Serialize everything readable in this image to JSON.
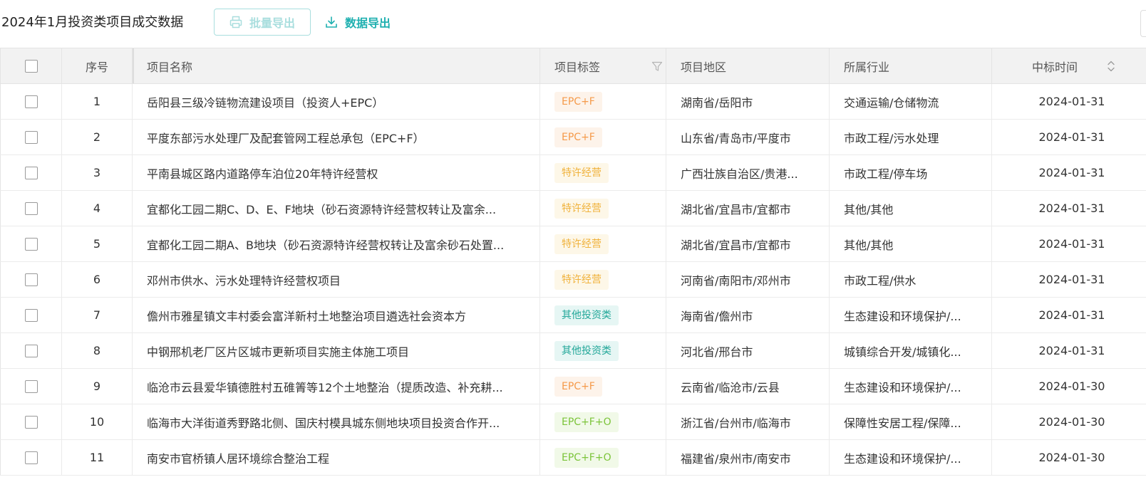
{
  "header": {
    "title": "2024年1月投资类项目成交数据",
    "batch_export_label": "批量导出",
    "data_export_label": "数据导出"
  },
  "table": {
    "columns": {
      "seq": "序号",
      "name": "项目名称",
      "tag": "项目标签",
      "region": "项目地区",
      "industry": "所属行业",
      "date": "中标时间"
    },
    "rows": [
      {
        "seq": "1",
        "name": "岳阳县三级冷链物流建设项目（投资人+EPC）",
        "tag": "EPC+F",
        "tag_style": "orange",
        "region": "湖南省/岳阳市",
        "industry": "交通运输/仓储物流",
        "date": "2024-01-31"
      },
      {
        "seq": "2",
        "name": "平度东部污水处理厂及配套管网工程总承包（EPC+F）",
        "tag": "EPC+F",
        "tag_style": "orange",
        "region": "山东省/青岛市/平度市",
        "industry": "市政工程/污水处理",
        "date": "2024-01-31"
      },
      {
        "seq": "3",
        "name": "平南县城区路内道路停车泊位20年特许经营权",
        "tag": "特许经营",
        "tag_style": "amber",
        "region": "广西壮族自治区/贵港...",
        "industry": "市政工程/停车场",
        "date": "2024-01-31"
      },
      {
        "seq": "4",
        "name": "宜都化工园二期C、D、E、F地块（砂石资源特许经营权转让及富余...",
        "tag": "特许经营",
        "tag_style": "amber",
        "region": "湖北省/宜昌市/宜都市",
        "industry": "其他/其他",
        "date": "2024-01-31"
      },
      {
        "seq": "5",
        "name": "宜都化工园二期A、B地块（砂石资源特许经营权转让及富余砂石处置...",
        "tag": "特许经营",
        "tag_style": "amber",
        "region": "湖北省/宜昌市/宜都市",
        "industry": "其他/其他",
        "date": "2024-01-31"
      },
      {
        "seq": "6",
        "name": "邓州市供水、污水处理特许经营权项目",
        "tag": "特许经营",
        "tag_style": "amber",
        "region": "河南省/南阳市/邓州市",
        "industry": "市政工程/供水",
        "date": "2024-01-31"
      },
      {
        "seq": "7",
        "name": "儋州市雅星镇文丰村委会富洋新村土地整治项目遴选社会资本方",
        "tag": "其他投资类",
        "tag_style": "teal",
        "region": "海南省/儋州市",
        "industry": "生态建设和环境保护/...",
        "date": "2024-01-31"
      },
      {
        "seq": "8",
        "name": "中钢邢机老厂区片区城市更新项目实施主体施工项目",
        "tag": "其他投资类",
        "tag_style": "teal",
        "region": "河北省/邢台市",
        "industry": "城镇综合开发/城镇化...",
        "date": "2024-01-31"
      },
      {
        "seq": "9",
        "name": "临沧市云县爱华镇德胜村五碓箐等12个土地整治（提质改造、补充耕...",
        "tag": "EPC+F",
        "tag_style": "orange",
        "region": "云南省/临沧市/云县",
        "industry": "生态建设和环境保护/...",
        "date": "2024-01-30"
      },
      {
        "seq": "10",
        "name": "临海市大洋街道秀野路北侧、国庆村模具城东侧地块项目投资合作开...",
        "tag": "EPC+F+O",
        "tag_style": "green",
        "region": "浙江省/台州市/临海市",
        "industry": "保障性安居工程/保障...",
        "date": "2024-01-30"
      },
      {
        "seq": "11",
        "name": "南安市官桥镇人居环境综合整治工程",
        "tag": "EPC+F+O",
        "tag_style": "green",
        "region": "福建省/泉州市/南安市",
        "industry": "生态建设和环境保护/...",
        "date": "2024-01-30"
      }
    ]
  },
  "colors": {
    "accent": "#1fb0b0",
    "tag_orange": "#f59a4a",
    "tag_amber": "#f0b23c",
    "tag_teal": "#24a89a",
    "tag_green": "#7cc43a"
  },
  "icons": {
    "batch_export": "printer-icon",
    "data_export": "download-icon",
    "tag_column": "filter-icon",
    "date_column": "sort-icon"
  }
}
